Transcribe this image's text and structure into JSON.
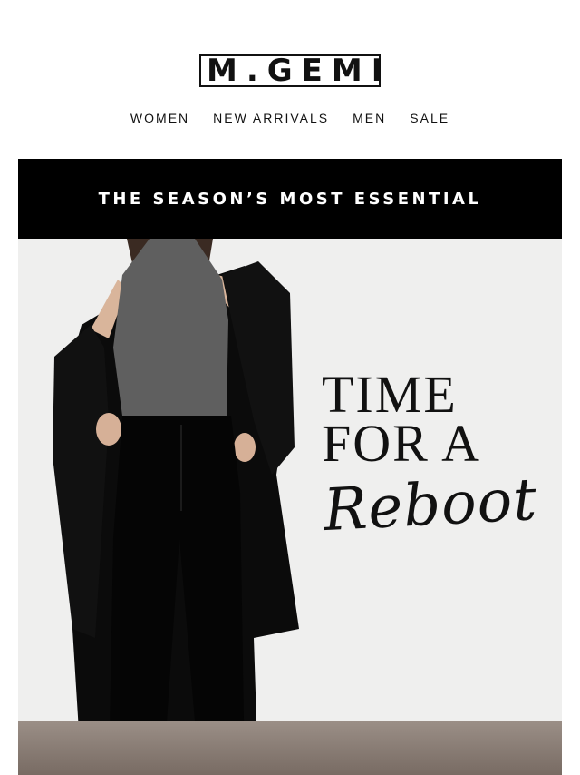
{
  "brand": {
    "logo_text": "M.GEMI"
  },
  "nav": {
    "items": [
      "WOMEN",
      "NEW ARRIVALS",
      "MEN",
      "SALE"
    ]
  },
  "banner": {
    "text": "THE SEASON’S MOST ESSENTIAL"
  },
  "hero": {
    "headline": [
      "TIME",
      "FOR A"
    ],
    "script": "Reboot"
  },
  "colors": {
    "banner_bg": "#000000",
    "text": "#111111",
    "page_bg": "#ffffff"
  }
}
